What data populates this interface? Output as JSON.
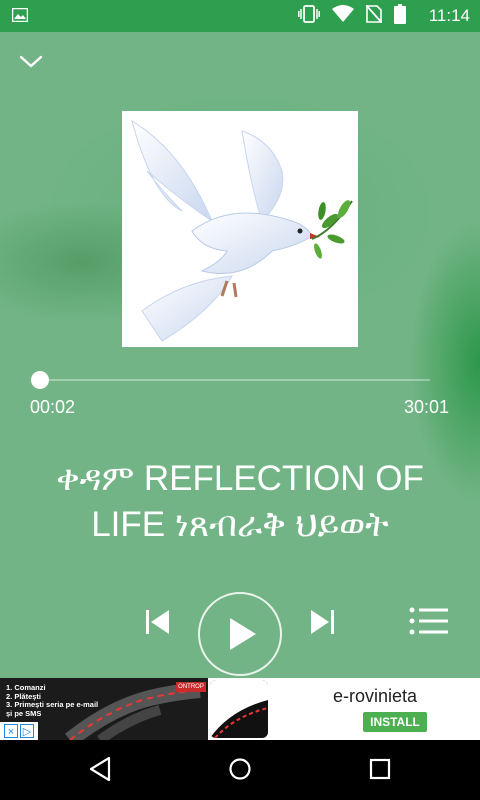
{
  "status_bar": {
    "time": "11:14",
    "icons": [
      "gallery-icon",
      "vibrate-icon",
      "wifi-icon",
      "no-sim-icon",
      "battery-icon"
    ]
  },
  "player": {
    "elapsed": "00:02",
    "duration": "30:01",
    "progress": 0.001,
    "title": "ቀዳም REFLECTION OF LIFE ነጸብራቅ ህይወት",
    "album_art": "dove-with-olive-branch",
    "controls": [
      "collapse-icon",
      "previous-icon",
      "play-icon",
      "next-icon",
      "queue-icon"
    ]
  },
  "ad": {
    "lines": [
      "1. Comanzi",
      "2. Plătești",
      "3. Primești seria pe e-mail",
      "și pe SMS"
    ],
    "brand": "ONTROP",
    "app_name": "e-rovinieta",
    "install_label": "INSTALL"
  },
  "nav_bar": {
    "buttons": [
      "back-icon",
      "home-icon",
      "recents-icon"
    ]
  },
  "colors": {
    "status_bar": "#2e9f4f",
    "player_bg": "#72b485",
    "install_button": "#4caf50"
  }
}
